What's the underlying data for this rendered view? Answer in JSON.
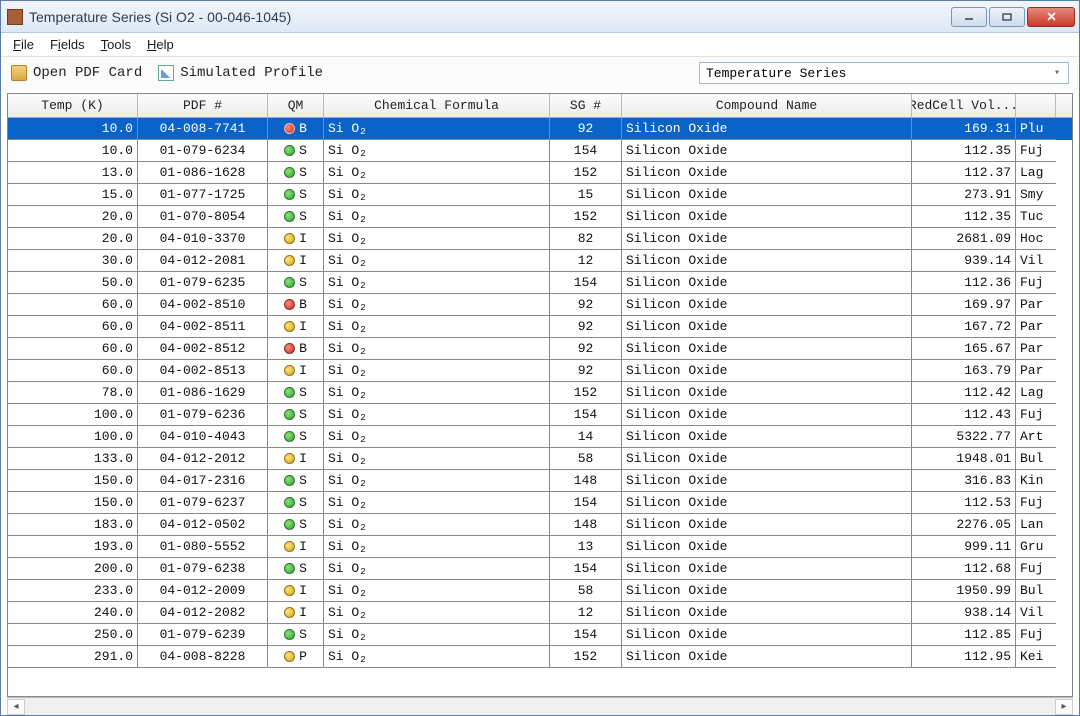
{
  "window": {
    "title": "Temperature Series (Si O2 - 00-046-1045)"
  },
  "menu": {
    "file": "File",
    "fields": "Fields",
    "tools": "Tools",
    "help": "Help"
  },
  "toolbar": {
    "open_pdf_label": "Open PDF Card",
    "sim_profile_label": "Simulated Profile",
    "series_select_value": "Temperature Series"
  },
  "columns": {
    "temp": "Temp (K)",
    "pdf": "PDF #",
    "qm": "QM",
    "chem": "Chemical Formula",
    "sg": "SG #",
    "compound": "Compound Name",
    "vol": "RedCell Vol..."
  },
  "chem_base": "Si O",
  "chem_sub": "2",
  "rows": [
    {
      "temp": "10.0",
      "pdf": "04-008-7741",
      "qm": "B",
      "sg": "92",
      "compound": "Silicon Oxide",
      "vol": "169.31",
      "last": "Plu",
      "sel": true
    },
    {
      "temp": "10.0",
      "pdf": "01-079-6234",
      "qm": "S",
      "sg": "154",
      "compound": "Silicon Oxide",
      "vol": "112.35",
      "last": "Fuj"
    },
    {
      "temp": "13.0",
      "pdf": "01-086-1628",
      "qm": "S",
      "sg": "152",
      "compound": "Silicon Oxide",
      "vol": "112.37",
      "last": "Lag"
    },
    {
      "temp": "15.0",
      "pdf": "01-077-1725",
      "qm": "S",
      "sg": "15",
      "compound": "Silicon Oxide",
      "vol": "273.91",
      "last": "Smy"
    },
    {
      "temp": "20.0",
      "pdf": "01-070-8054",
      "qm": "S",
      "sg": "152",
      "compound": "Silicon Oxide",
      "vol": "112.35",
      "last": "Tuc"
    },
    {
      "temp": "20.0",
      "pdf": "04-010-3370",
      "qm": "I",
      "sg": "82",
      "compound": "Silicon Oxide",
      "vol": "2681.09",
      "last": "Hoc"
    },
    {
      "temp": "30.0",
      "pdf": "04-012-2081",
      "qm": "I",
      "sg": "12",
      "compound": "Silicon Oxide",
      "vol": "939.14",
      "last": "Vil"
    },
    {
      "temp": "50.0",
      "pdf": "01-079-6235",
      "qm": "S",
      "sg": "154",
      "compound": "Silicon Oxide",
      "vol": "112.36",
      "last": "Fuj"
    },
    {
      "temp": "60.0",
      "pdf": "04-002-8510",
      "qm": "B",
      "sg": "92",
      "compound": "Silicon Oxide",
      "vol": "169.97",
      "last": "Par"
    },
    {
      "temp": "60.0",
      "pdf": "04-002-8511",
      "qm": "I",
      "sg": "92",
      "compound": "Silicon Oxide",
      "vol": "167.72",
      "last": "Par"
    },
    {
      "temp": "60.0",
      "pdf": "04-002-8512",
      "qm": "B",
      "sg": "92",
      "compound": "Silicon Oxide",
      "vol": "165.67",
      "last": "Par"
    },
    {
      "temp": "60.0",
      "pdf": "04-002-8513",
      "qm": "I",
      "sg": "92",
      "compound": "Silicon Oxide",
      "vol": "163.79",
      "last": "Par"
    },
    {
      "temp": "78.0",
      "pdf": "01-086-1629",
      "qm": "S",
      "sg": "152",
      "compound": "Silicon Oxide",
      "vol": "112.42",
      "last": "Lag"
    },
    {
      "temp": "100.0",
      "pdf": "01-079-6236",
      "qm": "S",
      "sg": "154",
      "compound": "Silicon Oxide",
      "vol": "112.43",
      "last": "Fuj"
    },
    {
      "temp": "100.0",
      "pdf": "04-010-4043",
      "qm": "S",
      "sg": "14",
      "compound": "Silicon Oxide",
      "vol": "5322.77",
      "last": "Art"
    },
    {
      "temp": "133.0",
      "pdf": "04-012-2012",
      "qm": "I",
      "sg": "58",
      "compound": "Silicon Oxide",
      "vol": "1948.01",
      "last": "Bul"
    },
    {
      "temp": "150.0",
      "pdf": "04-017-2316",
      "qm": "S",
      "sg": "148",
      "compound": "Silicon Oxide",
      "vol": "316.83",
      "last": "Kin"
    },
    {
      "temp": "150.0",
      "pdf": "01-079-6237",
      "qm": "S",
      "sg": "154",
      "compound": "Silicon Oxide",
      "vol": "112.53",
      "last": "Fuj"
    },
    {
      "temp": "183.0",
      "pdf": "04-012-0502",
      "qm": "S",
      "sg": "148",
      "compound": "Silicon Oxide",
      "vol": "2276.05",
      "last": "Lan"
    },
    {
      "temp": "193.0",
      "pdf": "01-080-5552",
      "qm": "I",
      "sg": "13",
      "compound": "Silicon Oxide",
      "vol": "999.11",
      "last": "Gru"
    },
    {
      "temp": "200.0",
      "pdf": "01-079-6238",
      "qm": "S",
      "sg": "154",
      "compound": "Silicon Oxide",
      "vol": "112.68",
      "last": "Fuj"
    },
    {
      "temp": "233.0",
      "pdf": "04-012-2009",
      "qm": "I",
      "sg": "58",
      "compound": "Silicon Oxide",
      "vol": "1950.99",
      "last": "Bul"
    },
    {
      "temp": "240.0",
      "pdf": "04-012-2082",
      "qm": "I",
      "sg": "12",
      "compound": "Silicon Oxide",
      "vol": "938.14",
      "last": "Vil"
    },
    {
      "temp": "250.0",
      "pdf": "01-079-6239",
      "qm": "S",
      "sg": "154",
      "compound": "Silicon Oxide",
      "vol": "112.85",
      "last": "Fuj"
    },
    {
      "temp": "291.0",
      "pdf": "04-008-8228",
      "qm": "P",
      "sg": "152",
      "compound": "Silicon Oxide",
      "vol": "112.95",
      "last": "Kei"
    }
  ]
}
